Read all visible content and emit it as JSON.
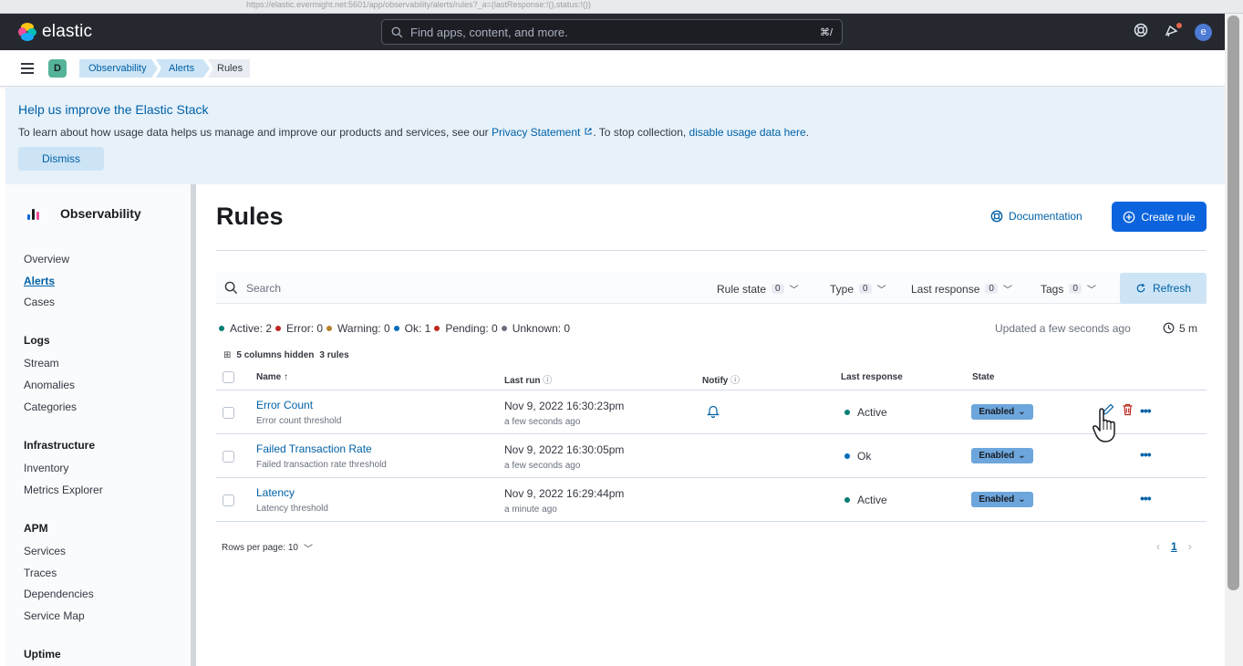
{
  "browser": {
    "url": "https://elastic.evermight.net:5601/app/observability/alerts/rules?_a=(lastResponse:!(),status:!())"
  },
  "header": {
    "logo_text": "elastic",
    "search_placeholder": "Find apps, content, and more.",
    "search_shortcut": "⌘/",
    "avatar_initial": "e"
  },
  "breadcrumbs": {
    "space_initial": "D",
    "items": [
      "Observability",
      "Alerts",
      "Rules"
    ]
  },
  "callout": {
    "title": "Help us improve the Elastic Stack",
    "text_before": "To learn about how usage data helps us manage and improve our products and services, see our ",
    "privacy_link": "Privacy Statement",
    "text_middle": ". To stop collection, ",
    "disable_link": "disable usage data here",
    "text_end": ".",
    "dismiss_label": "Dismiss"
  },
  "sidebar": {
    "title": "Observability",
    "items": [
      "Overview",
      "Alerts",
      "Cases"
    ],
    "groups": [
      {
        "label": "Logs",
        "items": [
          "Stream",
          "Anomalies",
          "Categories"
        ]
      },
      {
        "label": "Infrastructure",
        "items": [
          "Inventory",
          "Metrics Explorer"
        ]
      },
      {
        "label": "APM",
        "items": [
          "Services",
          "Traces",
          "Dependencies",
          "Service Map"
        ]
      },
      {
        "label": "Uptime",
        "items": []
      }
    ]
  },
  "page": {
    "title": "Rules",
    "doc_label": "Documentation",
    "create_label": "Create rule"
  },
  "filters": {
    "search_placeholder": "Search",
    "rule_state": {
      "label": "Rule state",
      "count": "0"
    },
    "type": {
      "label": "Type",
      "count": "0"
    },
    "last_response": {
      "label": "Last response",
      "count": "0"
    },
    "tags": {
      "label": "Tags",
      "count": "0"
    },
    "refresh_label": "Refresh"
  },
  "status": {
    "active": "Active: 2",
    "error": "Error: 0",
    "warning": "Warning: 0",
    "ok": "Ok: 1",
    "pending": "Pending: 0",
    "unknown": "Unknown: 0",
    "updated": "Updated a few seconds ago",
    "interval": "5 m",
    "colors": {
      "active": "#017d73",
      "error": "#bd271e",
      "warning": "#b5822c",
      "ok": "#006bb8",
      "pending": "#bd271e",
      "unknown": "#69707d"
    }
  },
  "table": {
    "hidden_columns": "5 columns hidden",
    "rule_count": "3 rules",
    "columns": {
      "name": "Name",
      "last_run": "Last run",
      "notify": "Notify",
      "last_response": "Last response",
      "state": "State"
    },
    "rows": [
      {
        "name": "Error Count",
        "type": "Error count threshold",
        "last_run": "Nov 9, 2022 16:30:23pm",
        "last_run_rel": "a few seconds ago",
        "last_response": "Active",
        "state": "Enabled"
      },
      {
        "name": "Failed Transaction Rate",
        "type": "Failed transaction rate threshold",
        "last_run": "Nov 9, 2022 16:30:05pm",
        "last_run_rel": "a few seconds ago",
        "last_response": "Ok",
        "state": "Enabled"
      },
      {
        "name": "Latency",
        "type": "Latency threshold",
        "last_run": "Nov 9, 2022 16:29:44pm",
        "last_run_rel": "a minute ago",
        "last_response": "Active",
        "state": "Enabled"
      }
    ],
    "rows_per_page": "Rows per page: 10",
    "current_page": "1"
  }
}
